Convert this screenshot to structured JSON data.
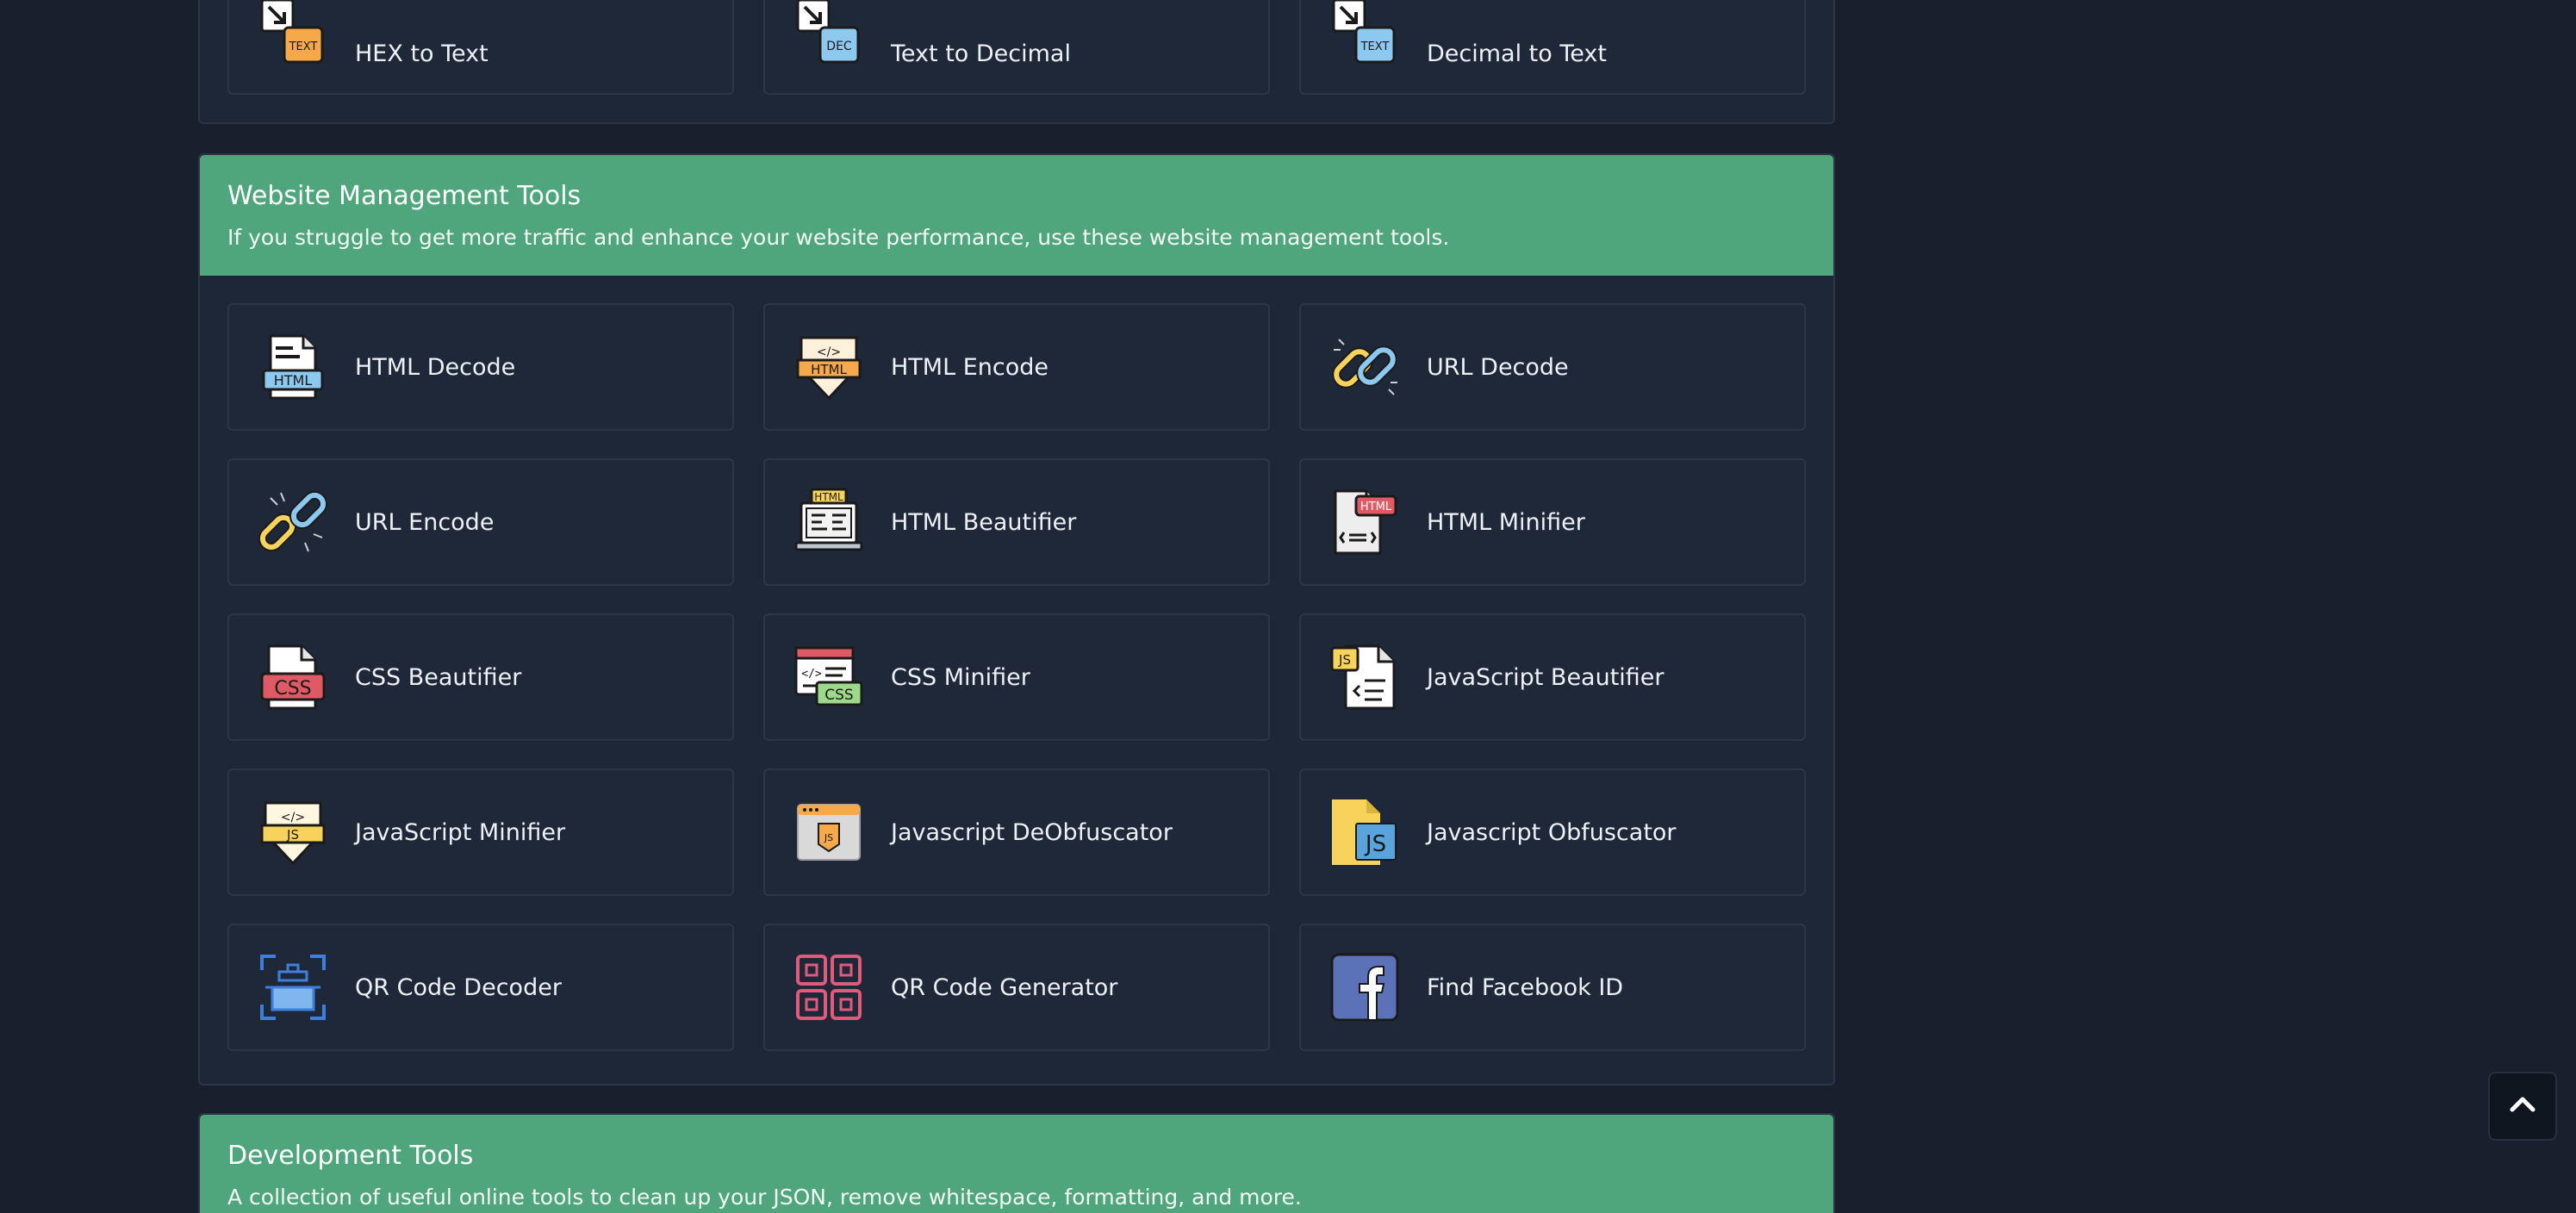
{
  "top_tools": [
    {
      "label": "HEX to Text",
      "icon": "hex-to-text-icon"
    },
    {
      "label": "Text to Decimal",
      "icon": "text-to-decimal-icon"
    },
    {
      "label": "Decimal to Text",
      "icon": "decimal-to-text-icon"
    }
  ],
  "website_section": {
    "title": "Website Management Tools",
    "description": "If you struggle to get more traffic and enhance your website performance, use these website management tools.",
    "tools": [
      {
        "label": "HTML Decode",
        "icon": "html-file-icon"
      },
      {
        "label": "HTML Encode",
        "icon": "html-badge-icon"
      },
      {
        "label": "URL Decode",
        "icon": "chain-link-icon"
      },
      {
        "label": "URL Encode",
        "icon": "broken-link-icon"
      },
      {
        "label": "HTML Beautifier",
        "icon": "html-laptop-icon"
      },
      {
        "label": "HTML Minifier",
        "icon": "html-doc-icon"
      },
      {
        "label": "CSS Beautifier",
        "icon": "css-file-icon"
      },
      {
        "label": "CSS Minifier",
        "icon": "css-window-icon"
      },
      {
        "label": "JavaScript Beautifier",
        "icon": "js-doc-icon"
      },
      {
        "label": "JavaScript Minifier",
        "icon": "js-badge-icon"
      },
      {
        "label": "Javascript DeObfuscator",
        "icon": "js-window-icon"
      },
      {
        "label": "Javascript Obfuscator",
        "icon": "js-file-icon"
      },
      {
        "label": "QR Code Decoder",
        "icon": "qr-scan-icon"
      },
      {
        "label": "QR Code Generator",
        "icon": "qr-code-icon"
      },
      {
        "label": "Find Facebook ID",
        "icon": "facebook-icon"
      }
    ]
  },
  "dev_section": {
    "title": "Development Tools",
    "description": "A collection of useful online tools to clean up your JSON, remove whitespace, formatting, and more."
  },
  "icon_texts": {
    "text": "TEXT",
    "dec": "DEC",
    "html": "HTML",
    "css": "CSS",
    "js": "JS"
  },
  "colors": {
    "page_bg": "#18202e",
    "panel_bg": "#1e2738",
    "header_green": "#4fa67c"
  }
}
